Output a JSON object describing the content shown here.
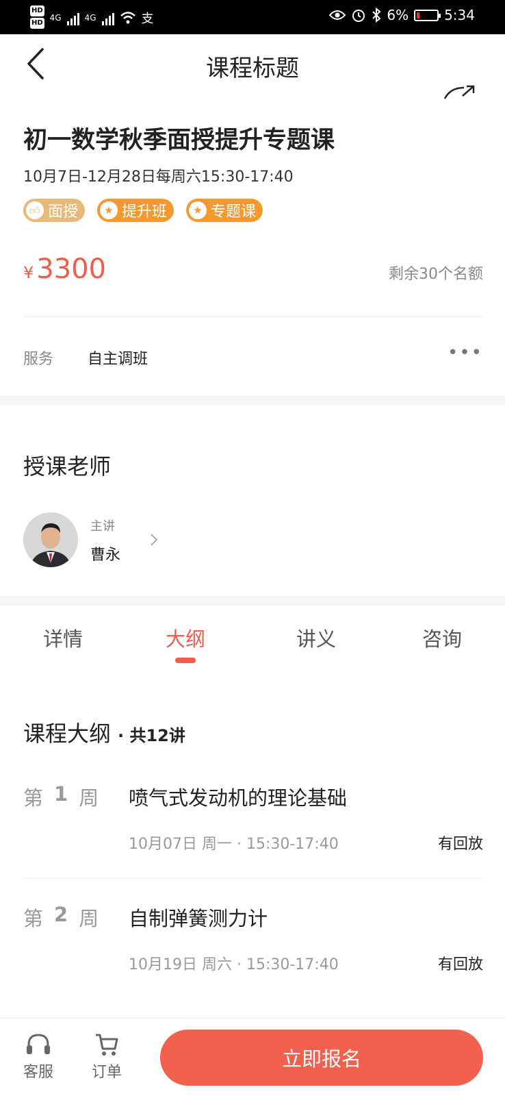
{
  "status_bar": {
    "network1": "4G",
    "network2": "4G",
    "pay_icon_char": "支",
    "battery": "6%",
    "time": "5:34",
    "battery_color": "#e53935"
  },
  "header": {
    "title": "课程标题"
  },
  "course": {
    "title": "初一数学秋季面授提升专题课",
    "schedule": "10月7日-12月28日每周六15:30-17:40",
    "tags": [
      {
        "label": "面授",
        "icon": "thumbs-up-icon"
      },
      {
        "label": "提升班",
        "icon": "star-icon"
      },
      {
        "label": "专题课",
        "icon": "star-icon"
      }
    ],
    "currency": "¥",
    "price": "3300",
    "quota": "剩余30个名额",
    "service_label": "服务",
    "service_value": "自主调班"
  },
  "teacher": {
    "heading": "授课老师",
    "role": "主讲",
    "name": "曹永"
  },
  "tabs": [
    "详情",
    "大纲",
    "讲义",
    "咨询"
  ],
  "active_tab": "大纲",
  "outline": {
    "heading": "课程大纲",
    "count": "· 共12讲",
    "lessons": [
      {
        "week_prefix": "第",
        "week_num": "1",
        "week_suffix": "周",
        "title": "喷气式发动机的理论基础",
        "meta": "10月07日 周一 · 15:30-17:40",
        "replay": "有回放"
      },
      {
        "week_prefix": "第",
        "week_num": "2",
        "week_suffix": "周",
        "title": "自制弹簧测力计",
        "meta": "10月19日 周六 · 15:30-17:40",
        "replay": "有回放"
      }
    ]
  },
  "bottom": {
    "service": "客服",
    "orders": "订单",
    "enroll": "立即报名"
  },
  "colors": {
    "accent": "#ef5c4a",
    "tag_gold": "#e6b979",
    "tag_orange": "#f5992e"
  }
}
